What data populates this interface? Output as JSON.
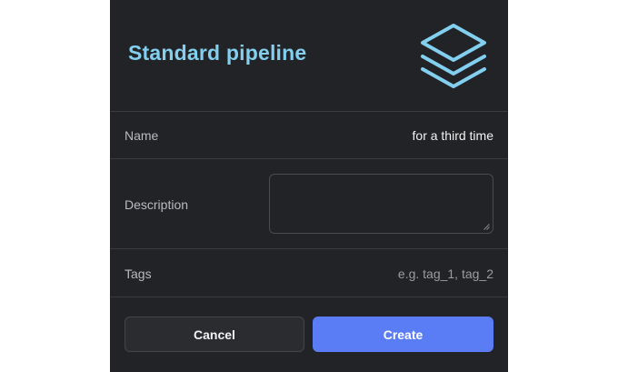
{
  "dialog": {
    "title": "Standard pipeline",
    "header_icon": "layers-icon",
    "fields": {
      "name": {
        "label": "Name",
        "value": "for a third time"
      },
      "description": {
        "label": "Description",
        "value": ""
      },
      "tags": {
        "label": "Tags",
        "placeholder": "e.g. tag_1, tag_2"
      }
    },
    "buttons": {
      "cancel_label": "Cancel",
      "create_label": "Create"
    }
  },
  "colors": {
    "background": "#222326",
    "accent_title": "#82cff0",
    "primary_button": "#5a7cf5",
    "icon": "#82cff0"
  }
}
